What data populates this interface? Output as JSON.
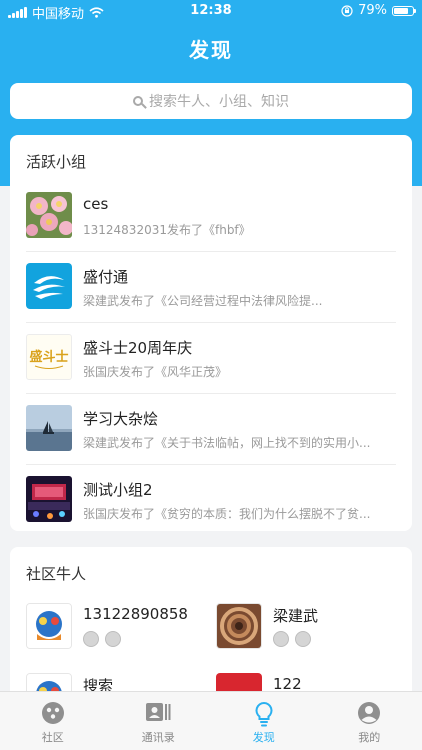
{
  "status_bar": {
    "carrier": "中国移动",
    "time": "12:38",
    "battery": "79%",
    "battery_level": 0.79
  },
  "nav": {
    "title": "发现"
  },
  "search": {
    "placeholder": "搜索牛人、小组、知识"
  },
  "active_groups": {
    "title": "活跃小组",
    "items": [
      {
        "name": "ces",
        "desc": "13124832031发布了《fhbf》",
        "thumb": "flowers"
      },
      {
        "name": "盛付通",
        "desc": "梁建武发布了《公司经营过程中法律风险提...",
        "thumb": "shengfutong-logo"
      },
      {
        "name": "盛斗士20周年庆",
        "desc": "张国庆发布了《风华正茂》",
        "thumb": "calligraphy",
        "thumb_text": "盛斗士"
      },
      {
        "name": "学习大杂烩",
        "desc": "梁建武发布了《关于书法临帖，网上找不到的实用小...",
        "thumb": "sailboat"
      },
      {
        "name": "测试小组2",
        "desc": "张国庆发布了《贫穷的本质：我们为什么摆脱不了贫...",
        "thumb": "stage"
      }
    ]
  },
  "community_experts": {
    "title": "社区牛人",
    "people": [
      {
        "name": "13122890858",
        "avatar": "cartoon"
      },
      {
        "name": "梁建武",
        "avatar": "spiral-stairs"
      },
      {
        "name": "搜索",
        "avatar": "cartoon"
      },
      {
        "name": "122",
        "avatar": "red"
      }
    ]
  },
  "tabbar": {
    "items": [
      {
        "label": "社区",
        "icon": "community-icon"
      },
      {
        "label": "通讯录",
        "icon": "contacts-icon"
      },
      {
        "label": "发现",
        "icon": "discover-icon",
        "active": true
      },
      {
        "label": "我的",
        "icon": "profile-icon"
      }
    ]
  },
  "colors": {
    "accent": "#29b0f0",
    "background": "#f2f3f5"
  }
}
